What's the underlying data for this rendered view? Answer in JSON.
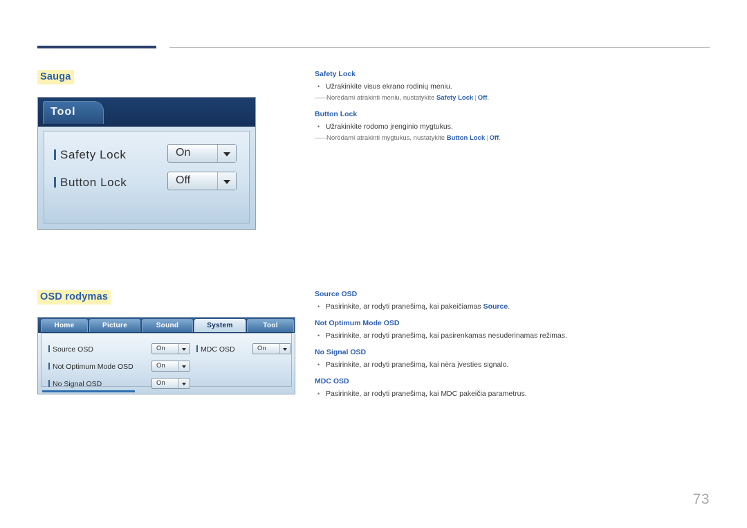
{
  "page": {
    "number": "73"
  },
  "sections": {
    "security": {
      "heading": "Sauga",
      "figure": {
        "tab_label": "Tool",
        "rows": [
          {
            "label": "Safety Lock",
            "value": "On"
          },
          {
            "label": "Button Lock",
            "value": "Off"
          }
        ]
      },
      "entries": [
        {
          "title": "Safety Lock",
          "bullet": "Užrakinkite visus ekrano rodinių meniu.",
          "note_prefix": "Norėdami atrakinti meniu, nustatykite ",
          "note_kw1": "Safety Lock",
          "note_sep": "|",
          "note_kw2": "Off",
          "note_suffix": "."
        },
        {
          "title": "Button Lock",
          "bullet": "Užrakinkite rodomo įrenginio mygtukus.",
          "note_prefix": "Norėdami atrakinti mygtukus, nustatykite ",
          "note_kw1": "Button Lock",
          "note_sep": "|",
          "note_kw2": "Off",
          "note_suffix": "."
        }
      ]
    },
    "osd": {
      "heading": "OSD rodymas",
      "figure": {
        "tabs": [
          "Home",
          "Picture",
          "Sound",
          "System",
          "Tool"
        ],
        "active_tab": "System",
        "rows_left": [
          {
            "label": "Source OSD",
            "value": "On"
          },
          {
            "label": "Not Optimum Mode OSD",
            "value": "On"
          },
          {
            "label": "No Signal OSD",
            "value": "On"
          }
        ],
        "rows_right": [
          {
            "label": "MDC OSD",
            "value": "On"
          }
        ]
      },
      "entries": [
        {
          "title": "Source OSD",
          "bullet_prefix": "Pasirinkite, ar rodyti pranešimą, kai pakeičiamas ",
          "bullet_kw": "Source",
          "bullet_suffix": "."
        },
        {
          "title": "Not Optimum Mode OSD",
          "bullet_prefix": "Pasirinkite, ar rodyti pranešimą, kai pasirenkamas nesuderinamas režimas.",
          "bullet_kw": "",
          "bullet_suffix": ""
        },
        {
          "title": "No Signal OSD",
          "bullet_prefix": "Pasirinkite, ar rodyti pranešimą, kai nėra įvesties signalo.",
          "bullet_kw": "",
          "bullet_suffix": ""
        },
        {
          "title": "MDC OSD",
          "bullet_prefix": "Pasirinkite, ar rodyti pranešimą, kai MDC pakeičia parametrus.",
          "bullet_kw": "",
          "bullet_suffix": ""
        }
      ]
    }
  },
  "symbols": {
    "bullet": "•",
    "note_dash": "――"
  }
}
